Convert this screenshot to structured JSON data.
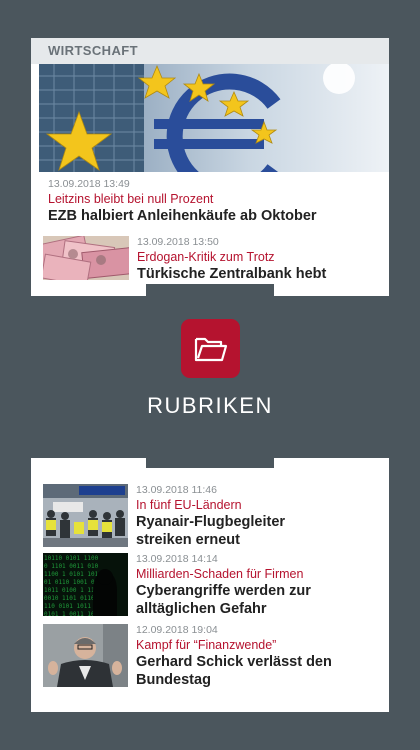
{
  "section": {
    "title": "WIRTSCHAFT"
  },
  "top_articles": [
    {
      "timestamp": "13.09.2018 13:49",
      "kicker": "Leitzins bleibt bei null Prozent",
      "headline": "EZB halbiert Anleihenkäufe ab Oktober"
    },
    {
      "timestamp": "13.09.2018 13:50",
      "kicker": "Erdogan-Kritik zum Trotz",
      "headline": "Türkische Zentralbank hebt"
    }
  ],
  "rubriken": {
    "label": "RUBRIKEN",
    "icon": "folder-open-icon"
  },
  "bottom_articles": [
    {
      "timestamp": "13.09.2018 11:46",
      "kicker": "In fünf EU-Ländern",
      "headline_1": "Ryanair-Flugbegleiter",
      "headline_2": "streiken erneut"
    },
    {
      "timestamp": "13.09.2018 14:14",
      "kicker": "Milliarden-Schaden für Firmen",
      "headline_1": "Cyberangriffe werden zur",
      "headline_2": "alltäglichen Gefahr"
    },
    {
      "timestamp": "12.09.2018 19:04",
      "kicker": "Kampf für “Finanzwende”",
      "headline_1": "Gerhard Schick verlässt den",
      "headline_2": "Bundestag"
    }
  ],
  "colors": {
    "accent": "#b5132f",
    "background": "#4b565d",
    "header_bg": "#e6e9eb"
  }
}
